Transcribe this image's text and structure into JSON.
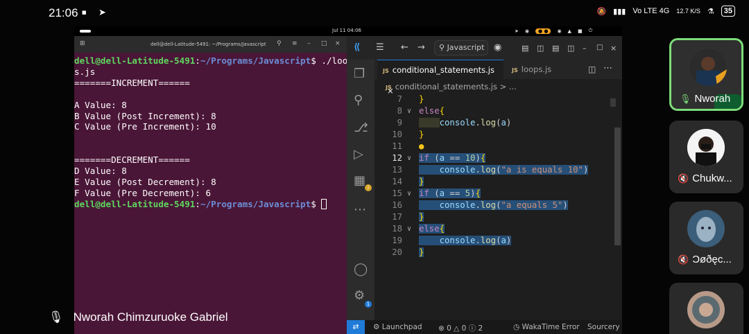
{
  "statusbar": {
    "time": "21:06",
    "network": "Vo LTE 4G",
    "speed": "12.7 K/S",
    "battery": "35"
  },
  "ubuntu_topbar": {
    "clock": "Jul 11 04:06"
  },
  "terminal": {
    "title": "dell@dell-Latitude-5491: ~/Programs/Javascript",
    "user": "dell@dell-Latitude-5491",
    "path": "~/Programs/Javascript",
    "command": "./loop",
    "command_wrap": "s.js",
    "output": [
      "=======INCREMENT======",
      "",
      "A Value: 8",
      "B Value (Post Increment): 8",
      "C Value (Pre Increment): 10",
      "",
      "",
      "=======DECREMENT======",
      "D Value: 8",
      "E Value (Post Decrement): 8",
      "F Value (Pre Decrement): 6"
    ]
  },
  "vscode": {
    "search_label": "Javascript",
    "tabs": [
      {
        "label": "conditional_statements.js",
        "active": true
      },
      {
        "label": "loops.js",
        "active": false
      }
    ],
    "breadcrumb": "conditional_statements.js",
    "breadcrumb_more": "> ...",
    "line_numbers": [
      "7",
      "8",
      "9",
      "10",
      "11",
      "12",
      "13",
      "14",
      "15",
      "16",
      "17",
      "18",
      "19",
      "20"
    ],
    "status": {
      "launchpad": "Launchpad",
      "problems": "0",
      "warnings": "0",
      "info": "2",
      "wakatime": "WakaTime Error",
      "sourcery": "Sourcery A"
    }
  },
  "speaker": {
    "name": "Nworah Chimzuruoke Gabriel"
  },
  "participants": [
    {
      "name": "Nworah",
      "muted": false,
      "active": true
    },
    {
      "name": "Chukw...",
      "muted": true,
      "active": false
    },
    {
      "name": "Ɔøðęc...",
      "muted": true,
      "active": false
    },
    {
      "name": "",
      "muted": false,
      "active": false
    }
  ],
  "colors": {
    "terminal_bg": "#4a1637",
    "vscode_bg": "#1e1e1e",
    "active_tile_border": "#7ddc7a",
    "selection": "#264f78"
  }
}
